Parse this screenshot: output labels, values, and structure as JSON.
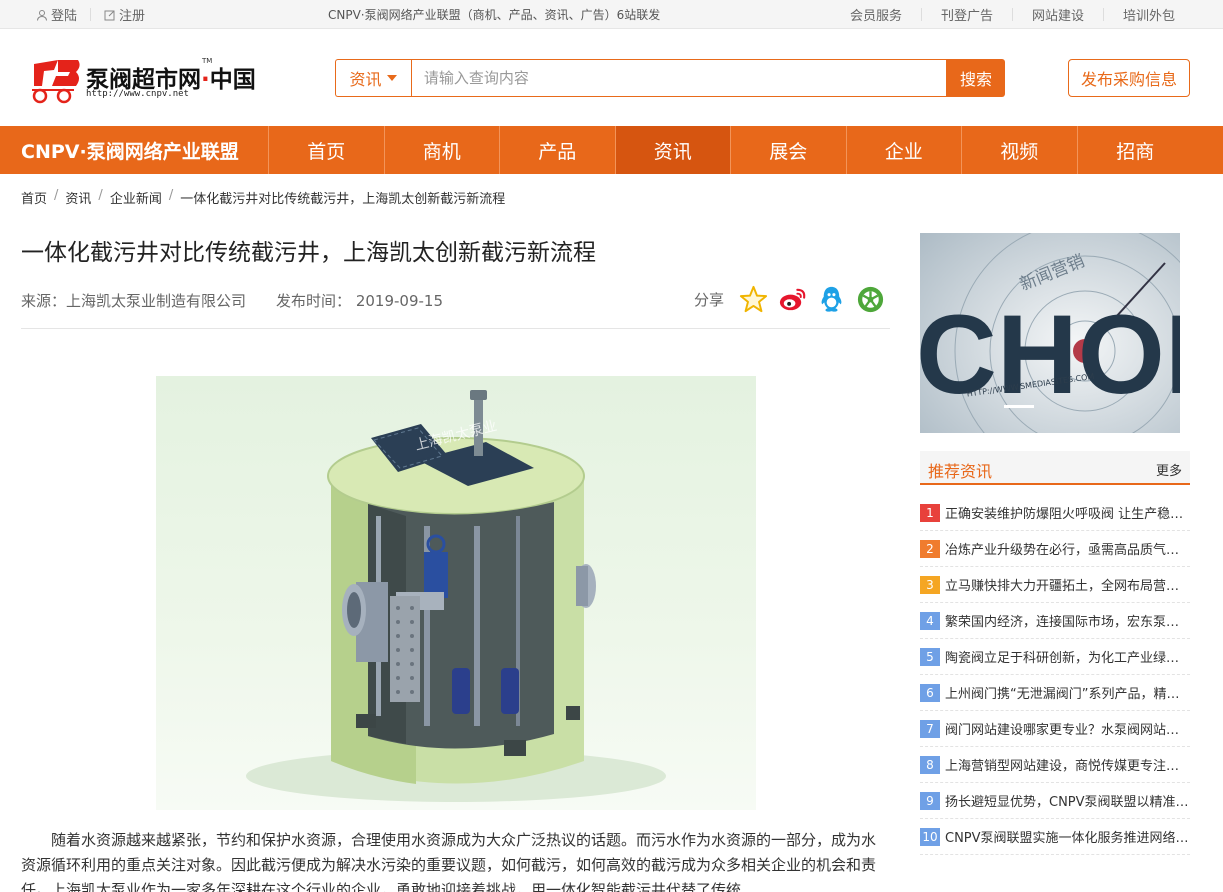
{
  "topbar": {
    "login": "登陆",
    "register": "注册",
    "center_text": "CNPV·泵阀网络产业联盟（商机、产品、资讯、广告）6站联发",
    "links": [
      "会员服务",
      "刊登广告",
      "网站建设",
      "培训外包"
    ]
  },
  "logo": {
    "name_a": "泵阀超市网",
    "name_dot": "·",
    "name_b": "中国",
    "tm": "TM",
    "url": "http://www.cnpv.net"
  },
  "search": {
    "category": "资讯",
    "placeholder": "请输入查询内容",
    "button": "搜索"
  },
  "publish_button": "发布采购信息",
  "nav": {
    "brand": "CNPV·泵阀网络产业联盟",
    "items": [
      "首页",
      "商机",
      "产品",
      "资讯",
      "展会",
      "企业",
      "视频",
      "招商"
    ],
    "active_index": 3
  },
  "breadcrumb": [
    "首页",
    "资讯",
    "企业新闻",
    "一体化截污井对比传统截污井，上海凯太创新截污新流程"
  ],
  "article": {
    "title": "一体化截污井对比传统截污井，上海凯太创新截污新流程",
    "source": "来源：上海凯太泵业制造有限公司",
    "date_label": "发布时间：",
    "date": "2019-09-15",
    "share_label": "分享",
    "share_icons": [
      "star-icon",
      "weibo-icon",
      "qq-icon",
      "wechat-moments-icon"
    ],
    "image_watermark": "上海凯太泵业",
    "paragraph": "随着水资源越来越紧张，节约和保护水资源，合理使用水资源成为大众广泛热议的话题。而污水作为水资源的一部分，成为水资源循环利用的重点关注对象。因此截污便成为解决水污染的重要议题，如何截污，如何高效的截污成为众多相关企业的机会和责任。上海凯太泵业作为一家多年深耕在这个行业的企业，勇敢地迎接着挑战，用一体化智能截污井代替了传统"
  },
  "sidebar": {
    "banner_text": "CHOICE",
    "banner_stamp": "新闻营销",
    "banner_url": "HTTP://WWW.SMEDIASITES.COM",
    "section_title": "推荐资讯",
    "more": "更多",
    "items": [
      {
        "n": "1",
        "text": "正确安装维护防爆阻火呼吸阀 让生产稳中求进"
      },
      {
        "n": "2",
        "text": "冶炼产业升级势在必行，亟需高品质气动阀门"
      },
      {
        "n": "3",
        "text": "立马赚快排大力开疆拓土，全网布局营销推广"
      },
      {
        "n": "4",
        "text": "繁荣国内经济，连接国际市场，宏东泵业加速发展"
      },
      {
        "n": "5",
        "text": "陶瓷阀立足于科研创新，为化工产业绿色发展助力"
      },
      {
        "n": "6",
        "text": "上州阀门携“无泄漏阀门”系列产品，精彩亮相展会"
      },
      {
        "n": "7",
        "text": "阀门网站建设哪家更专业？水泵阀网站建设首选"
      },
      {
        "n": "8",
        "text": "上海营销型网站建设，商悦传媒更专注泵阀行业"
      },
      {
        "n": "9",
        "text": "扬长避短显优势，CNPV泵阀联盟以精准营销见长"
      },
      {
        "n": "10",
        "text": "CNPV泵阀联盟实施一体化服务推进网络营销"
      }
    ],
    "num_colors": [
      "#e8413b",
      "#f07c2e",
      "#f5a623",
      "#6fa0e6",
      "#6fa0e6",
      "#6fa0e6",
      "#6fa0e6",
      "#6fa0e6",
      "#6fa0e6",
      "#6fa0e6"
    ]
  },
  "colors": {
    "accent": "#e8681a",
    "nav_active": "#d65510"
  }
}
